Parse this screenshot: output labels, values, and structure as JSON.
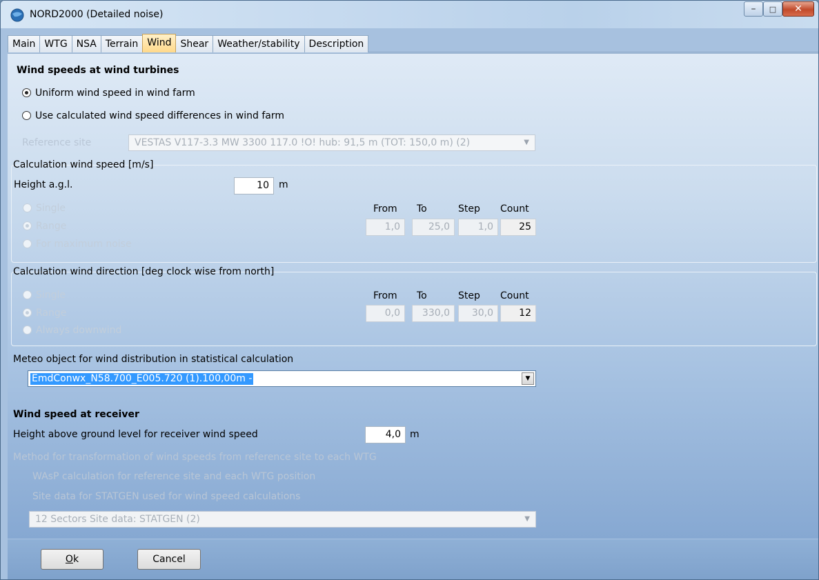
{
  "window": {
    "title": "NORD2000 (Detailed noise)"
  },
  "tabs": [
    "Main",
    "WTG",
    "NSA",
    "Terrain",
    "Wind",
    "Shear",
    "Weather/stability",
    "Description"
  ],
  "active_tab": "Wind",
  "turbines": {
    "heading": "Wind speeds at wind turbines",
    "opt_uniform": "Uniform wind speed in wind farm",
    "opt_calc": "Use calculated wind speed differences in wind farm",
    "ref_label": "Reference site",
    "ref_value": "VESTAS V117-3.3 MW  3300 117.0 !O! hub: 91,5 m (TOT: 150,0 m) (2)"
  },
  "speed_group": {
    "label": "Calculation wind speed [m/s]",
    "height_label": "Height a.g.l.",
    "height_value": "10",
    "height_unit": "m",
    "opt_single": "Single",
    "opt_range": "Range",
    "opt_max": "For maximum noise",
    "col_from": "From",
    "col_to": "To",
    "col_step": "Step",
    "col_count": "Count",
    "from": "1,0",
    "to": "25,0",
    "step": "1,0",
    "count": "25"
  },
  "dir_group": {
    "label": "Calculation wind direction [deg clock wise from north]",
    "opt_single": "Single",
    "opt_range": "Range",
    "opt_down": "Always downwind",
    "col_from": "From",
    "col_to": "To",
    "col_step": "Step",
    "col_count": "Count",
    "from": "0,0",
    "to": "330,0",
    "step": "30,0",
    "count": "12"
  },
  "meteo": {
    "label": "Meteo object for wind distribution in statistical calculation",
    "value": "EmdConwx_N58.700_E005.720 (1).100,00m -"
  },
  "receiver": {
    "heading": "Wind speed at receiver",
    "height_label": "Height above ground level for receiver wind speed",
    "height_value": "4,0",
    "height_unit": "m",
    "method_label": "Method for transformation of wind speeds from reference site to each WTG",
    "opt_wasp": "WAsP calculation for reference site and each WTG position",
    "opt_statgen": "Site data for STATGEN used for wind speed calculations",
    "sector_value": "12 Sectors  Site data: STATGEN (2)"
  },
  "buttons": {
    "ok_prefix": "O",
    "ok_rest": "k",
    "cancel": "Cancel"
  }
}
